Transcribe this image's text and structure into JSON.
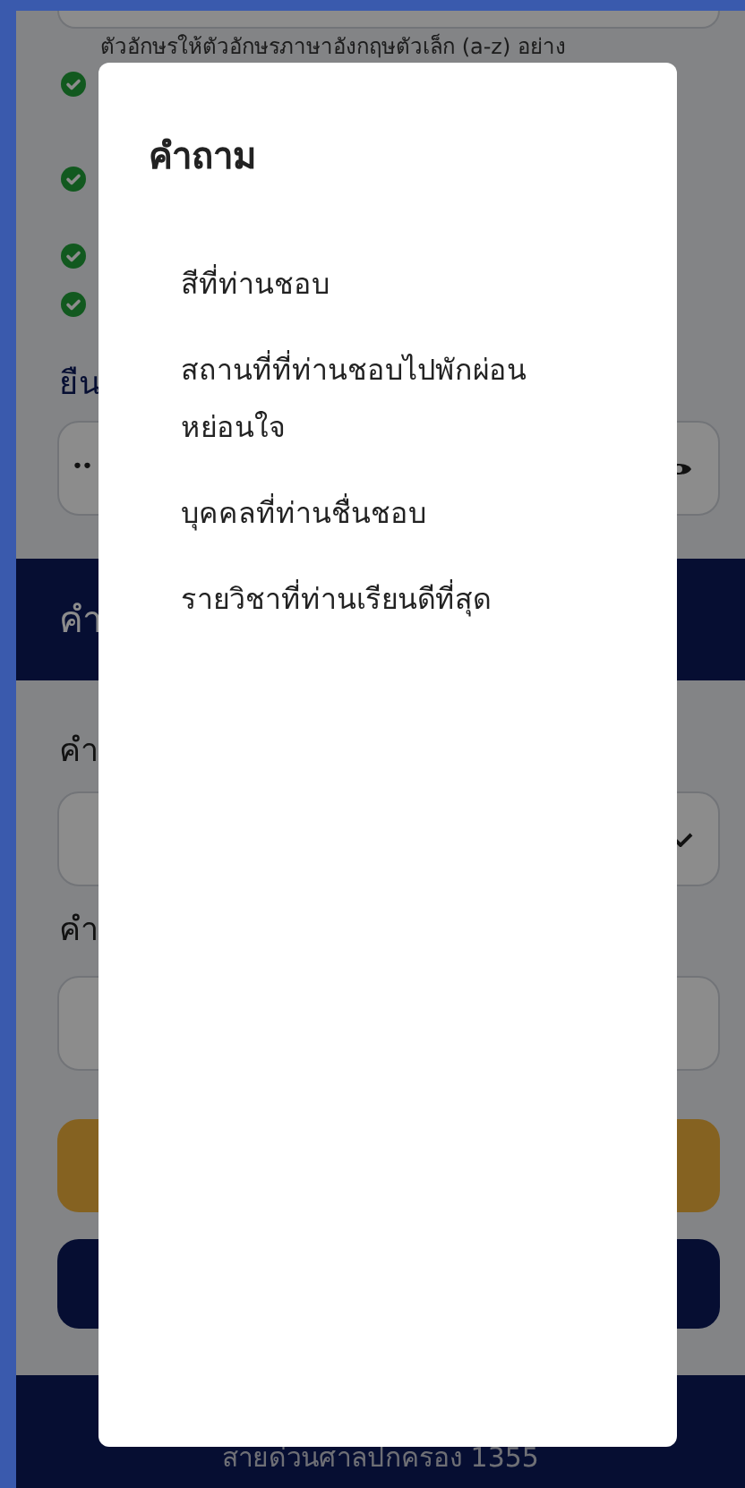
{
  "background": {
    "requirements": [
      {
        "text": "ตัวอักษรให้ตัวอักษรภาษาอังกฤษตัวเล็ก (a-z) อย่าง",
        "checked": true
      },
      {
        "checked": true
      },
      {
        "checked": true
      },
      {
        "checked": true
      }
    ],
    "confirm_label": "ยืน",
    "password_value": "••",
    "section_title": "คำ",
    "question_label": "คำ",
    "answer_label": "คำ",
    "footer": "สายด่วนศาลปกครอง 1355"
  },
  "dialog": {
    "title": "คำถาม",
    "options": [
      "สีที่ท่านชอบ",
      "สถานที่ที่ท่านชอบไปพักผ่อนหย่อนใจ",
      "บุคคลที่ท่านชื่นชอบ",
      "รายวิชาที่ท่านเรียนดีที่สุด"
    ]
  }
}
